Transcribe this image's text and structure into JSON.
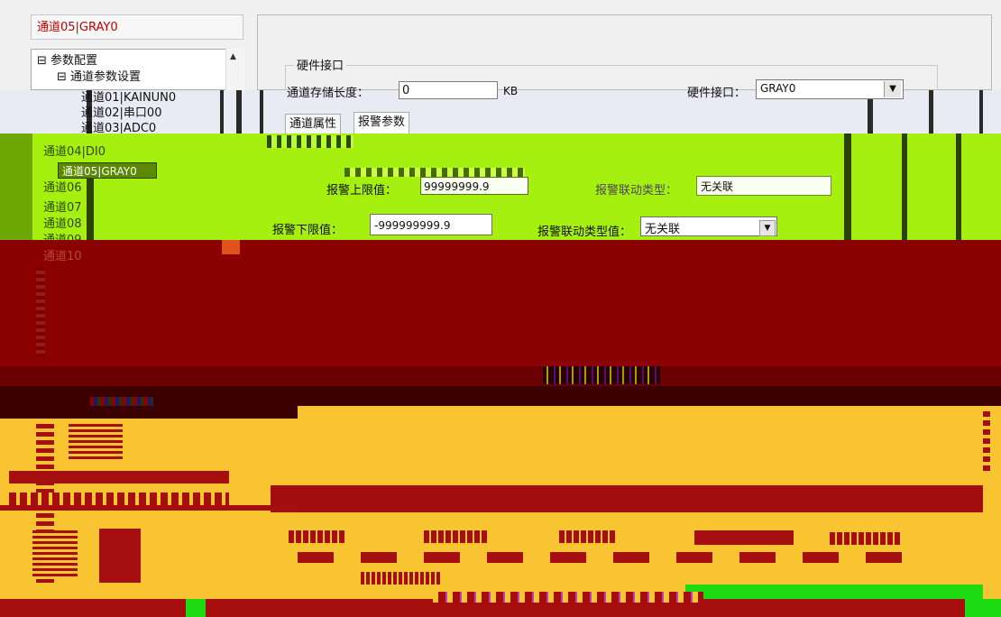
{
  "window": {
    "title": "通道05|GRAY0"
  },
  "tree": {
    "items": [
      "参数配置",
      "通道参数设置",
      "通道01|KAINUN0",
      "通道02|串口00",
      "通道03|ADC0",
      "通道04|DI0",
      "通道05|GRAY0",
      "通道06",
      "通道07",
      "通道08",
      "通道09",
      "通道10"
    ]
  },
  "hardware": {
    "group_label": "硬件接口",
    "storage_label": "通道存储长度：",
    "storage_value": "0",
    "storage_unit": "KB",
    "port_label": "硬件接口：",
    "port_value": "GRAY0"
  },
  "tabs": {
    "channel_attributes": "通道属性",
    "alarm_params": "报警参数"
  },
  "alarm": {
    "upper_label": "报警上限值：",
    "upper_value": "99999999.9",
    "link_type_label": "报警联动类型：",
    "link_type_value": "无关联",
    "lower_label": "报警下限值：",
    "lower_value": "-999999999.9",
    "link_value_label": "报警联动类型值：",
    "link_value_value": "无关联"
  },
  "colors": {
    "title_red": "#c00000",
    "band_green": "#a6f011",
    "band_maroon": "#8b0000",
    "band_gold": "#f8c431",
    "band_bottom_green": "#1edc11"
  }
}
